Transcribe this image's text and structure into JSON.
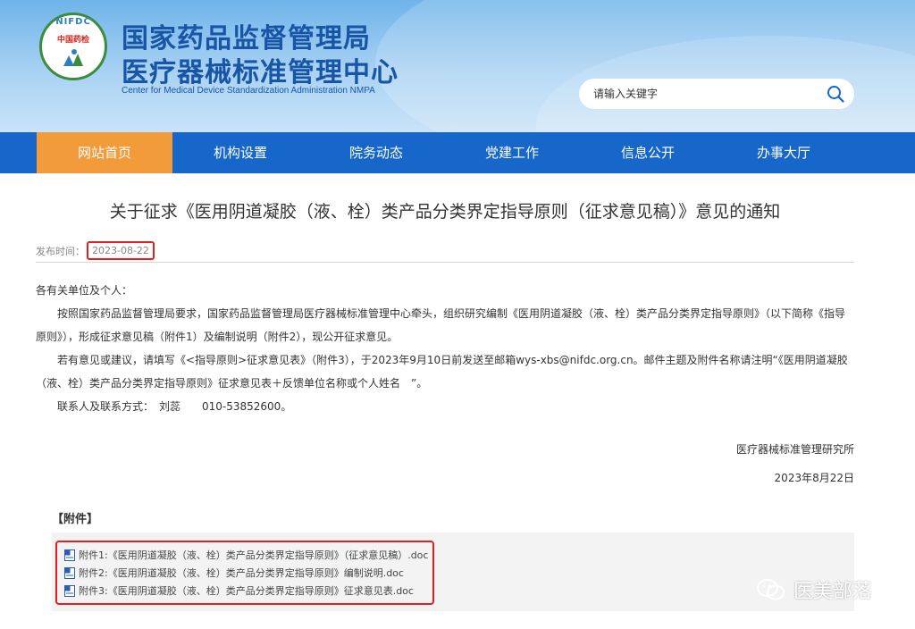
{
  "header": {
    "logo_top_text": "NIFDC",
    "logo_red_text": "中国药检",
    "title_line1": "国家药品监督管理局",
    "title_line2": "医疗器械标准管理中心",
    "title_en": "Center for Medical Device Standardization Administration NMPA",
    "search_placeholder": "请输入关键字"
  },
  "nav": {
    "items": [
      {
        "label": "网站首页",
        "active": true
      },
      {
        "label": "机构设置",
        "active": false
      },
      {
        "label": "院务动态",
        "active": false
      },
      {
        "label": "党建工作",
        "active": false
      },
      {
        "label": "信息公开",
        "active": false
      },
      {
        "label": "办事大厅",
        "active": false
      }
    ]
  },
  "article": {
    "title": "关于征求《医用阴道凝胶（液、栓）类产品分类界定指导原则（征求意见稿）》意见的通知",
    "publish_label": "发布时间：",
    "publish_date": "2023-08-22",
    "salutation": "各有关单位及个人：",
    "para1": "按照国家药品监督管理局要求，国家药品监督管理局医疗器械标准管理中心牵头，组织研究编制《医用阴道凝胶（液、栓）类产品分类界定指导原则》（以下简称《指导原则》），形成征求意见稿（附件1）及编制说明（附件2），现公开征求意见。",
    "para2": "若有意见或建议，请填写《<指导原则>征求意见表》（附件3），于2023年9月10日前发送至邮箱wys-xbs@nifdc.org.cn。邮件主题及附件名称请注明“《医用阴道凝胶（液、栓）类产品分类界定指导原则》征求意见表＋反馈单位名称或个人姓名　”。",
    "contact": "联系人及联系方式：　刘蕊　　010-53852600。",
    "sign_org": "医疗器械标准管理研究所",
    "sign_date": "2023年8月22日"
  },
  "attachments": {
    "heading": "【附件】",
    "items": [
      "附件1:《医用阴道凝胶（液、栓）类产品分类界定指导原则》（征求意见稿）.doc",
      "附件2:《医用阴道凝胶（液、栓）类产品分类界定指导原则》编制说明.doc",
      "附件3:《医用阴道凝胶（液、栓）类产品分类界定指导原则》征求意见表.doc"
    ]
  },
  "watermark": {
    "text": "医美部落",
    "icon": "wechat-icon"
  },
  "colors": {
    "nav_bg": "#1667c9",
    "nav_active": "#f19b3a",
    "title_blue": "#1855a6",
    "highlight_red": "#e02020"
  }
}
